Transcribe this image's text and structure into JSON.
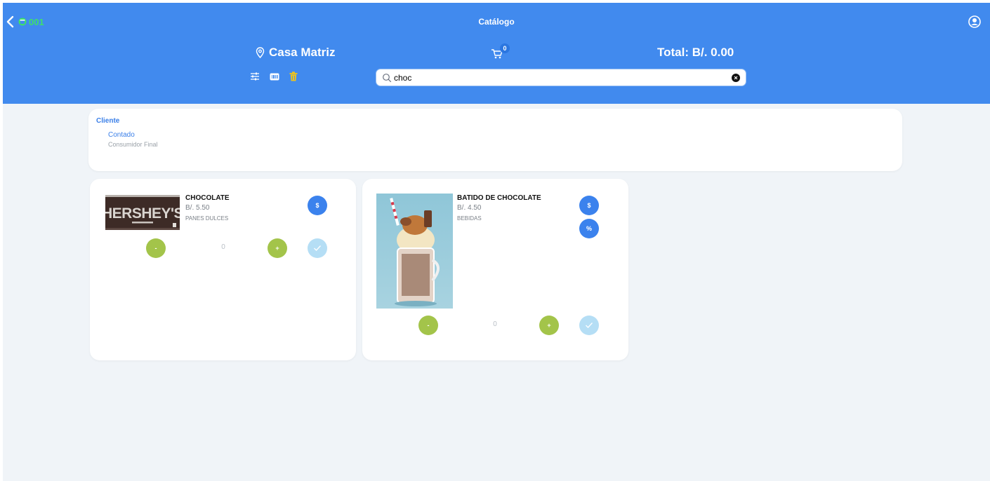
{
  "header": {
    "store_code": "001",
    "title": "Catálogo",
    "branch": "Casa Matriz",
    "cart_count": "0",
    "total": "Total: B/. 0.00",
    "accent": "#418aee"
  },
  "search": {
    "value": "choc",
    "placeholder": ""
  },
  "client": {
    "label": "Cliente",
    "type": "Contado",
    "name": "Consumidor Final"
  },
  "products": [
    {
      "name": "CHOCOLATE",
      "price": "B/. 5.50",
      "category": "PANES DULCES",
      "image_text": "HERSHEY'S",
      "price_button": "$",
      "minus": "-",
      "plus": "+",
      "quantity": "0"
    },
    {
      "name": "BATIDO DE CHOCOLATE",
      "price": "B/. 4.50",
      "category": "BEBIDAS",
      "price_button": "$",
      "discount_button": "%",
      "minus": "-",
      "plus": "+",
      "quantity": "0"
    }
  ],
  "colors": {
    "action_blue": "#3b82ed",
    "green": "#a3c44a",
    "confirm_disabled": "#b5def5",
    "delete": "#f0c419"
  }
}
